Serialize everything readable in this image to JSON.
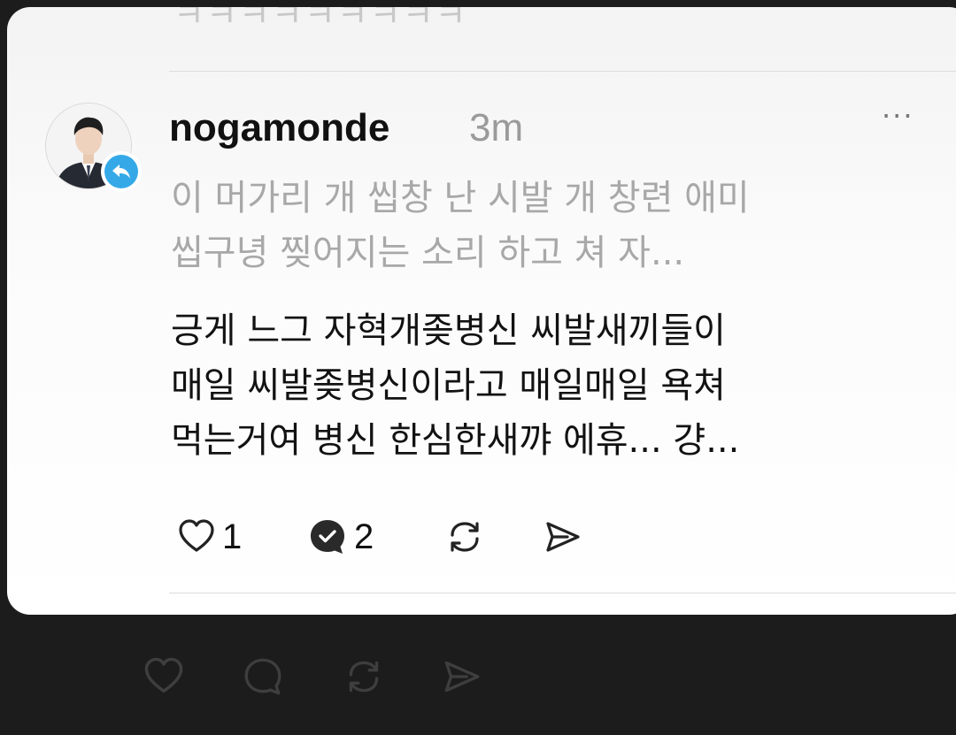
{
  "above_post_text": "ㅋㅋㅋㅋㅋㅋㅋㅋㅋ",
  "post": {
    "username": "nogamonde",
    "time": "3m",
    "more_label": "···",
    "quoted_lines": [
      "이 머가리 개 씹창 난 시발 개 창련 애미",
      "씹구녕 찢어지는 소리 하고 쳐 자..."
    ],
    "body_lines": [
      "긍게 느그 자혁개좆병신 씨발새끼들이",
      "매일 씨발좆병신이라고 매일매일 욕쳐",
      "먹는거여 병신 한심한새꺄 에휴... 걍..."
    ],
    "actions": {
      "like_count": "1",
      "reply_count": "2"
    },
    "icons": {
      "like": "heart-icon",
      "reply": "reply-bubble-icon",
      "repost": "repost-icon",
      "share": "send-icon",
      "badge": "reply-arrow-icon"
    }
  },
  "colors": {
    "badge": "#35a9e8",
    "dark_bg": "#1c1c1c"
  }
}
